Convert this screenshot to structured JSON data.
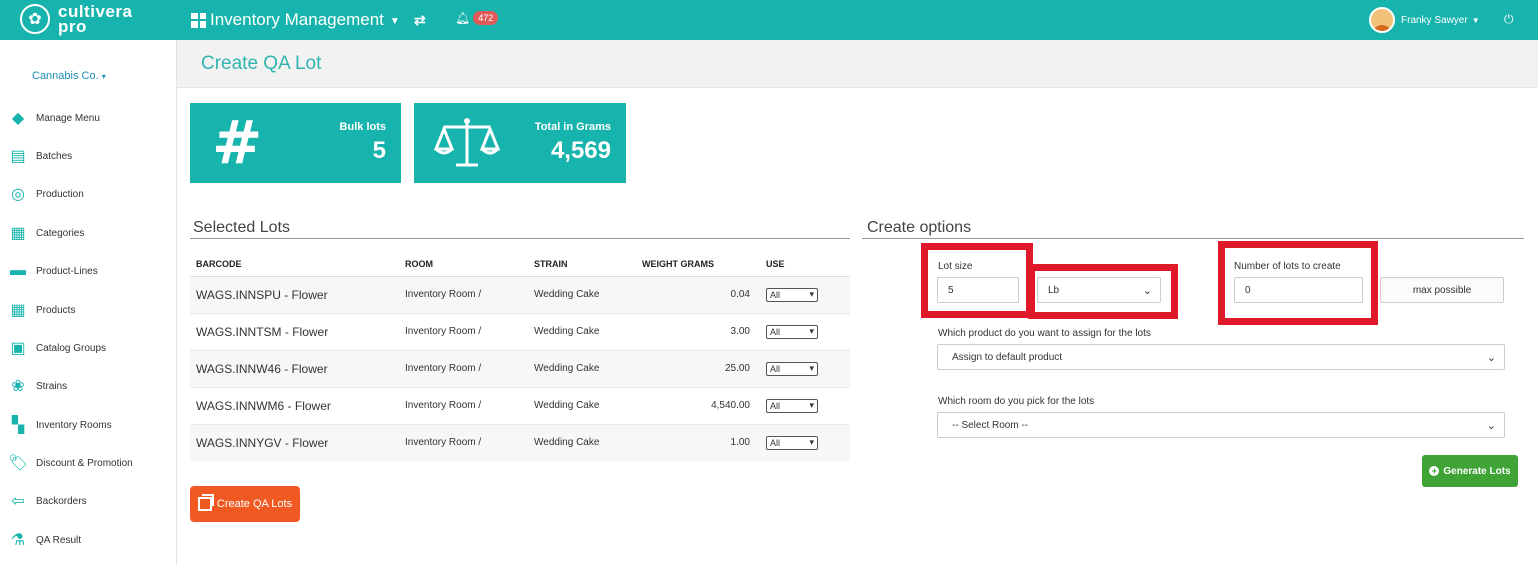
{
  "brand": {
    "line1": "cultivera",
    "line2": "pro"
  },
  "header": {
    "app_title": "Inventory Management",
    "notifications": "472",
    "user_name": "Franky Sawyer"
  },
  "sidebar": {
    "company": "Cannabis Co.",
    "items": [
      {
        "label": "Manage Menu"
      },
      {
        "label": "Batches"
      },
      {
        "label": "Production"
      },
      {
        "label": "Categories"
      },
      {
        "label": "Product-Lines"
      },
      {
        "label": "Products"
      },
      {
        "label": "Catalog Groups"
      },
      {
        "label": "Strains"
      },
      {
        "label": "Inventory Rooms"
      },
      {
        "label": "Discount & Promotion"
      },
      {
        "label": "Backorders"
      },
      {
        "label": "QA Result"
      }
    ]
  },
  "page": {
    "title": "Create QA Lot"
  },
  "stats": {
    "bulk": {
      "label": "Bulk lots",
      "value": "5"
    },
    "grams": {
      "label": "Total in Grams",
      "value": "4,569"
    }
  },
  "selected_lots": {
    "title": "Selected Lots",
    "columns": [
      "BARCODE",
      "ROOM",
      "STRAIN",
      "WEIGHT GRAMS",
      "USE"
    ],
    "rows": [
      {
        "barcode": "WAGS.INNSPU - Flower",
        "room": "Inventory Room /",
        "strain": "Wedding Cake",
        "weight": "0.04",
        "use": "All"
      },
      {
        "barcode": "WAGS.INNTSM - Flower",
        "room": "Inventory Room /",
        "strain": "Wedding Cake",
        "weight": "3.00",
        "use": "All"
      },
      {
        "barcode": "WAGS.INNW46 - Flower",
        "room": "Inventory Room /",
        "strain": "Wedding Cake",
        "weight": "25.00",
        "use": "All"
      },
      {
        "barcode": "WAGS.INNWM6 - Flower",
        "room": "Inventory Room /",
        "strain": "Wedding Cake",
        "weight": "4,540.00",
        "use": "All"
      },
      {
        "barcode": "WAGS.INNYGV - Flower",
        "room": "Inventory Room /",
        "strain": "Wedding Cake",
        "weight": "1.00",
        "use": "All"
      }
    ],
    "create_button": "Create QA Lots"
  },
  "create_options": {
    "title": "Create options",
    "lot_size_label": "Lot size",
    "lot_size_value": "5",
    "unit_value": "Lb",
    "num_lots_label": "Number of lots to create",
    "num_lots_value": "0",
    "max_possible": "max possible",
    "product_label": "Which product do you want to assign for the lots",
    "product_value": "Assign to default product",
    "room_label": "Which room do you pick for the lots",
    "room_value": "-- Select Room --",
    "generate_button": "Generate Lots"
  },
  "colors": {
    "brand": "#17b4ad",
    "orange": "#f05a22",
    "green": "#3fa435",
    "highlight": "#e0192a"
  }
}
